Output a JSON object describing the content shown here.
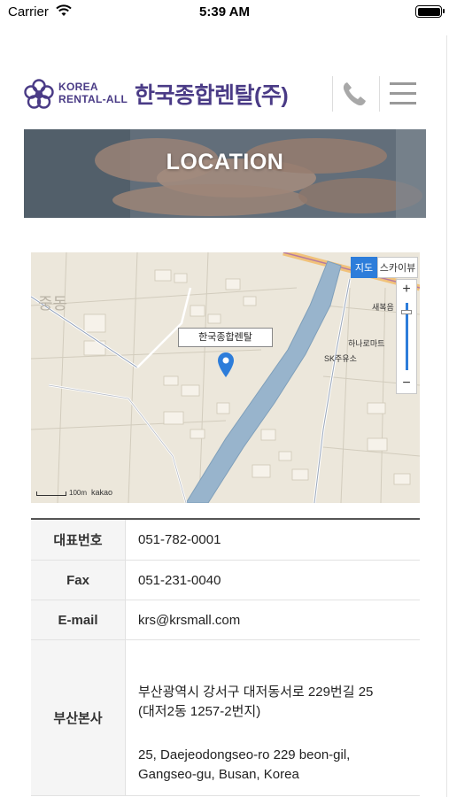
{
  "status_bar": {
    "carrier": "Carrier",
    "time": "5:39 AM",
    "icons": [
      "wifi-icon",
      "battery-icon"
    ]
  },
  "header": {
    "logo_en_line1": "KOREA",
    "logo_en_line2": "RENTAL-ALL",
    "logo_ko": "한국종합렌탈(주)",
    "brand_color": "#4a3b86",
    "phone_icon": "phone-icon",
    "menu_icon": "hamburger-menu-icon"
  },
  "banner": {
    "title": "LOCATION"
  },
  "map": {
    "type_buttons": [
      "지도",
      "스카이뷰"
    ],
    "selected_type": "지도",
    "zoom_in": "+",
    "zoom_out": "−",
    "place_label": "한국종합렌탈",
    "area_label": "중동",
    "poi_labels": [
      "새복음",
      "하나로마트",
      "SK주유소"
    ],
    "scale": "100m",
    "provider": "kakao",
    "accent_color": "#2d7dda"
  },
  "info": {
    "rows": [
      {
        "label": "대표번호",
        "value": "051-782-0001"
      },
      {
        "label": "Fax",
        "value": "051-231-0040"
      },
      {
        "label": "E-mail",
        "value": "krs@krsmall.com"
      },
      {
        "label": "부산본사",
        "address_ko_line1": "부산광역시 강서구 대저동서로 229번길 25",
        "address_ko_line2": "(대저2동 1257-2번지)",
        "address_en_line1": "25, Daejeodongseo-ro 229 beon-gil,",
        "address_en_line2": "Gangseo-gu, Busan, Korea"
      }
    ]
  }
}
